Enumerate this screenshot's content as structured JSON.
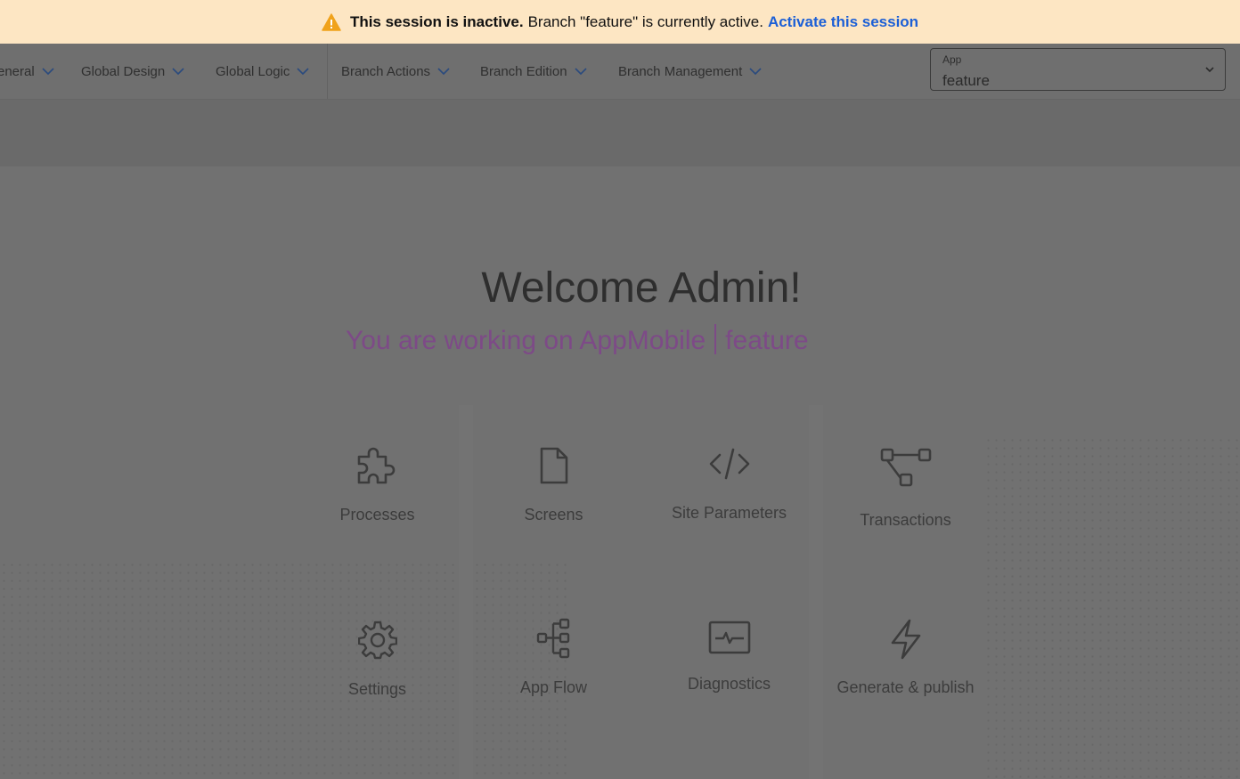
{
  "banner": {
    "strong": "This session is inactive.",
    "message": "Branch \"feature\" is currently active.",
    "link": "Activate this session",
    "icon": "warning-icon",
    "warning_color": "#f0a21b",
    "link_color": "#1b5fd6"
  },
  "nav": [
    {
      "label": "eneral",
      "icon": "chevron-down-icon"
    },
    {
      "label": "Global Design",
      "icon": "chevron-down-icon"
    },
    {
      "label": "Global Logic",
      "icon": "chevron-down-icon"
    },
    {
      "label": "Branch Actions",
      "icon": "chevron-down-icon"
    },
    {
      "label": "Branch Edition",
      "icon": "chevron-down-icon"
    },
    {
      "label": "Branch Management",
      "icon": "chevron-down-icon"
    }
  ],
  "app_select": {
    "label": "App",
    "value": "feature",
    "icon": "chevron-down-icon"
  },
  "welcome": {
    "title": "Welcome Admin!",
    "working_on": "You are working on AppMobile",
    "branch": "feature",
    "accent_color": "#7d4a87"
  },
  "tiles": [
    {
      "label": "Processes",
      "icon": "puzzle-icon"
    },
    {
      "label": "Screens",
      "icon": "document-icon"
    },
    {
      "label": "Site Parameters",
      "icon": "code-icon"
    },
    {
      "label": "Transactions",
      "icon": "transactions-icon"
    },
    {
      "label": "Settings",
      "icon": "gear-icon"
    },
    {
      "label": "App Flow",
      "icon": "flow-icon"
    },
    {
      "label": "Diagnostics",
      "icon": "diagnostics-icon"
    },
    {
      "label": "Generate & publish",
      "icon": "lightning-icon"
    }
  ]
}
